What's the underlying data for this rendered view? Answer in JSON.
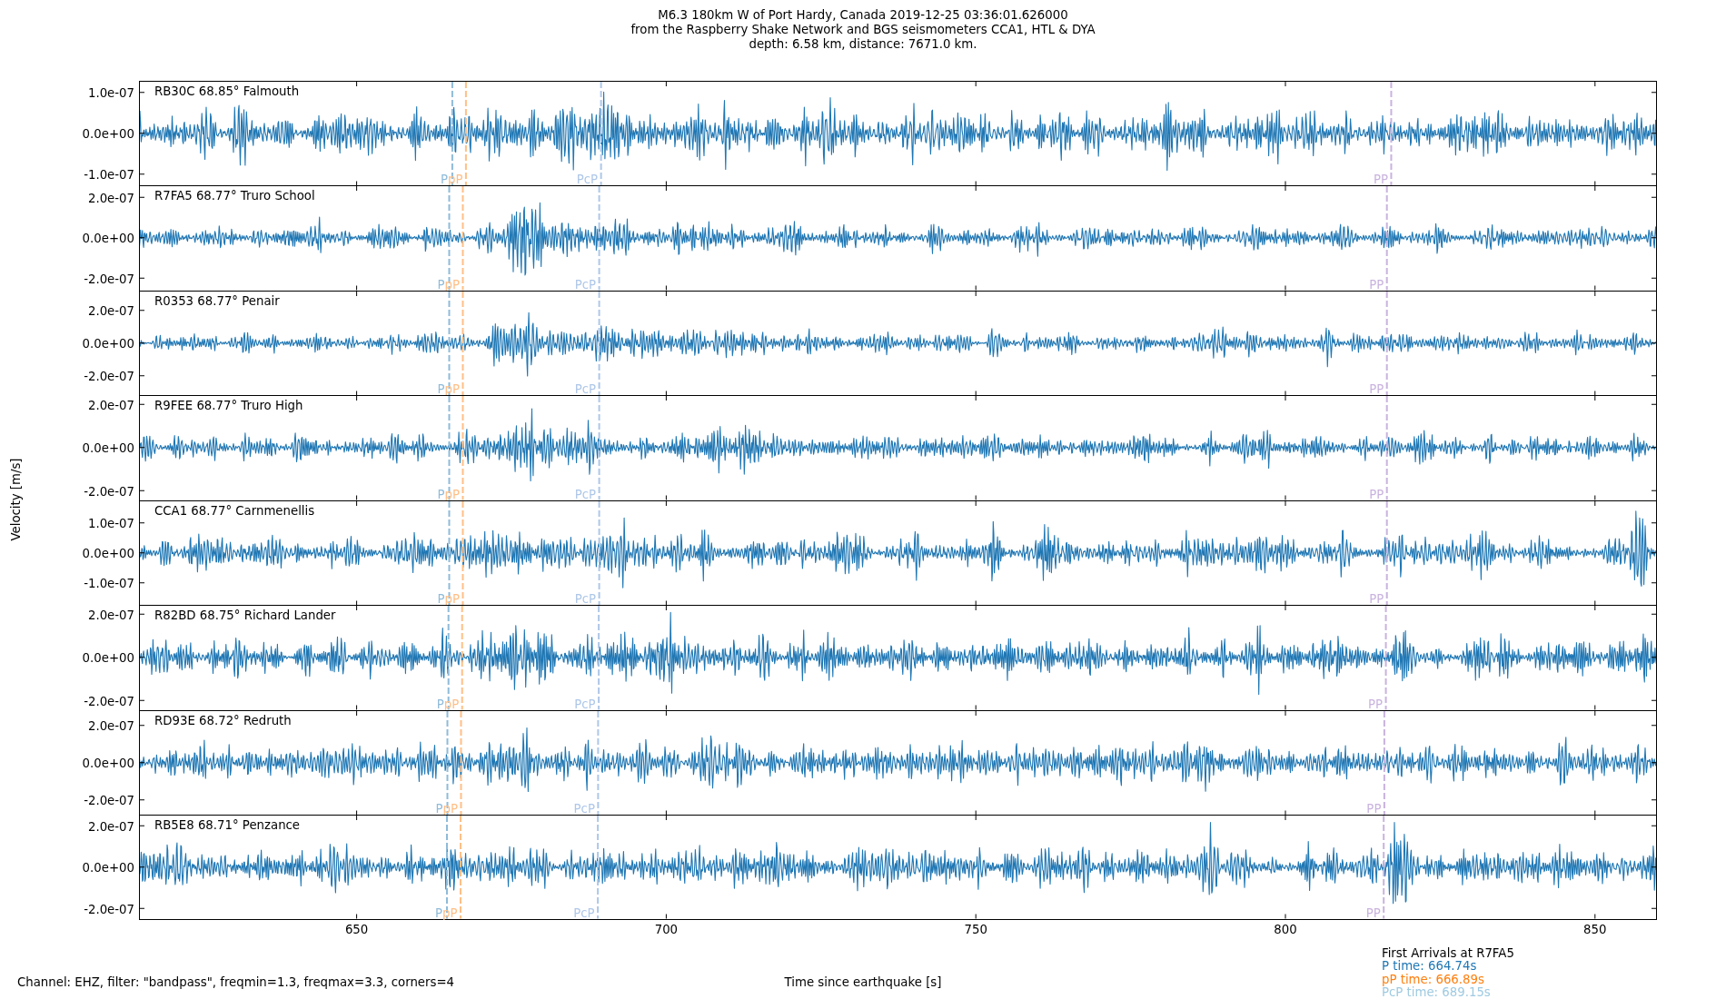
{
  "title": [
    "M6.3 180km W of Port Hardy, Canada 2019-12-25 03:36:01.626000",
    "from the Raspberry Shake Network and BGS seismometers CCA1, HTL & DYA",
    "depth: 6.58 km, distance: 7671.0 km."
  ],
  "y_axis_label": "Velocity [m/s]",
  "panels": [
    {
      "label": "RB30C 68.85° Falmouth",
      "y_ticks": [
        "1.0e-07",
        "0.0e+00",
        "-1.0e-07"
      ],
      "phases": [
        {
          "label": "P",
          "color": "#8fbbd9"
        },
        {
          "label": "pP",
          "color": "#ffbf86"
        },
        {
          "label": "PcP",
          "color": "#aec7e8"
        },
        {
          "label": "PP",
          "color": "#c9b3de"
        }
      ]
    },
    {
      "label": "R7FA5 68.77° Truro School",
      "y_ticks": [
        "2.0e-07",
        "0.0e+00",
        "-2.0e-07"
      ],
      "phases": [
        {
          "label": "P",
          "color": "#8fbbd9"
        },
        {
          "label": "pP",
          "color": "#ffbf86"
        },
        {
          "label": "PcP",
          "color": "#aec7e8"
        },
        {
          "label": "PP",
          "color": "#c9b3de"
        }
      ]
    },
    {
      "label": "R0353 68.77° Penair",
      "y_ticks": [
        "2.0e-07",
        "0.0e+00",
        "-2.0e-07"
      ],
      "phases": [
        {
          "label": "P",
          "color": "#8fbbd9"
        },
        {
          "label": "pP",
          "color": "#ffbf86"
        },
        {
          "label": "PcP",
          "color": "#aec7e8"
        },
        {
          "label": "PP",
          "color": "#c9b3de"
        }
      ]
    },
    {
      "label": "R9FEE 68.77° Truro High",
      "y_ticks": [
        "2.0e-07",
        "0.0e+00",
        "-2.0e-07"
      ],
      "phases": [
        {
          "label": "P",
          "color": "#8fbbd9"
        },
        {
          "label": "pP",
          "color": "#ffbf86"
        },
        {
          "label": "PcP",
          "color": "#aec7e8"
        },
        {
          "label": "PP",
          "color": "#c9b3de"
        }
      ]
    },
    {
      "label": "CCA1 68.77° Carnmenellis",
      "y_ticks": [
        "1.0e-07",
        "0.0e+00",
        "-1.0e-07"
      ],
      "phases": [
        {
          "label": "P",
          "color": "#8fbbd9"
        },
        {
          "label": "pP",
          "color": "#ffbf86"
        },
        {
          "label": "PcP",
          "color": "#aec7e8"
        },
        {
          "label": "PP",
          "color": "#c9b3de"
        }
      ]
    },
    {
      "label": "R82BD 68.75° Richard Lander",
      "y_ticks": [
        "2.0e-07",
        "0.0e+00",
        "-2.0e-07"
      ],
      "phases": [
        {
          "label": "P",
          "color": "#8fbbd9"
        },
        {
          "label": "pP",
          "color": "#ffbf86"
        },
        {
          "label": "PcP",
          "color": "#aec7e8"
        },
        {
          "label": "PP",
          "color": "#c9b3de"
        }
      ]
    },
    {
      "label": "RD93E 68.72° Redruth",
      "y_ticks": [
        "2.0e-07",
        "0.0e+00",
        "-2.0e-07"
      ],
      "phases": [
        {
          "label": "P",
          "color": "#8fbbd9"
        },
        {
          "label": "pP",
          "color": "#ffbf86"
        },
        {
          "label": "PcP",
          "color": "#aec7e8"
        },
        {
          "label": "PP",
          "color": "#c9b3de"
        }
      ]
    },
    {
      "label": "RB5E8 68.71° Penzance",
      "y_ticks": [
        "2.0e-07",
        "0.0e+00",
        "-2.0e-07"
      ],
      "phases": [
        {
          "label": "P",
          "color": "#8fbbd9"
        },
        {
          "label": "pP",
          "color": "#ffbf86"
        },
        {
          "label": "PcP",
          "color": "#aec7e8"
        },
        {
          "label": "PP",
          "color": "#c9b3de"
        }
      ]
    }
  ],
  "x_ticks": [
    "650",
    "700",
    "750",
    "800",
    "850"
  ],
  "x_axis_label": "Time since earthquake [s]",
  "footnote": "Channel: EHZ, filter: \"bandpass\", freqmin=1.3, freqmax=3.3, corners=4",
  "legend": {
    "title": "First Arrivals at R7FA5",
    "entries": [
      {
        "text": "P time: 664.74s",
        "color": "#1f77b4"
      },
      {
        "text": "pP time: 666.89s",
        "color": "#ff7f0e"
      },
      {
        "text": "PcP time: 689.15s",
        "color": "#9ecae1"
      }
    ]
  }
}
